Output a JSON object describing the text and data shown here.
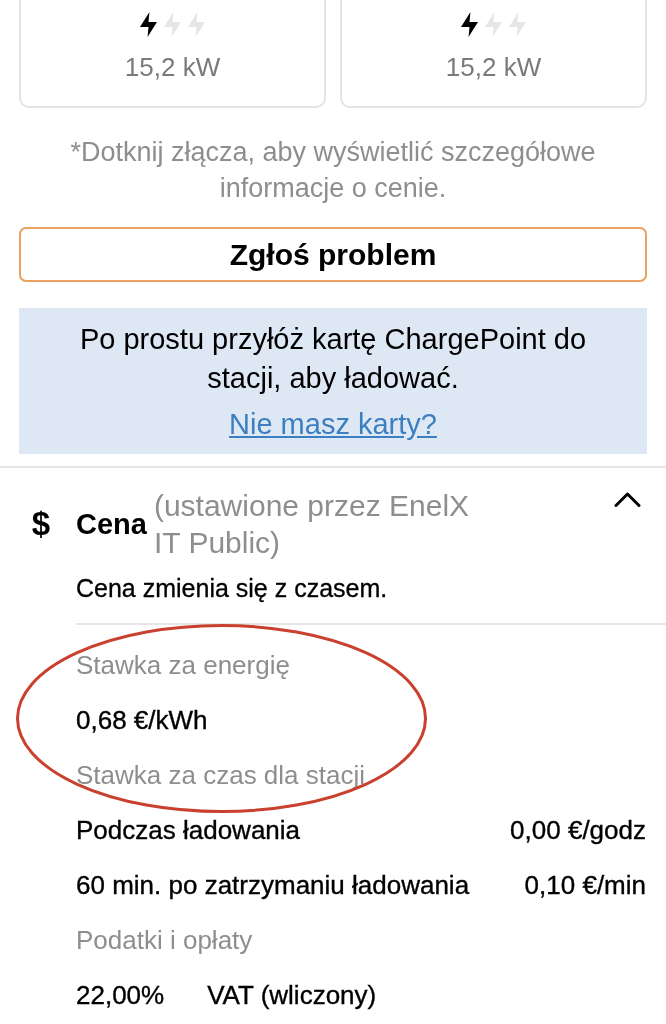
{
  "connectors": [
    {
      "stars": 1,
      "power": "15,2 kW"
    },
    {
      "stars": 1,
      "power": "15,2 kW"
    }
  ],
  "connector_hint": "*Dotknij złącza, aby wyświetlić szczegółowe informacje o cenie.",
  "report_button": {
    "label": "Zgłoś problem"
  },
  "card_notice": {
    "text": "Po prostu przyłóż kartę ChargePoint do stacji, aby ładować.",
    "link": "Nie masz karty?"
  },
  "price": {
    "symbol": "$",
    "title": "Cena",
    "provider": "(ustawione przez EnelX IT Public)",
    "expanded": true,
    "note": "Cena zmienia się z czasem.",
    "circled": true,
    "sections": [
      {
        "heading": "Stawka za energię",
        "rows": [
          {
            "kind": "amount",
            "value": "0,68 €/kWh"
          }
        ]
      },
      {
        "heading": "Stawka za czas dla stacji",
        "rows": [
          {
            "kind": "rate",
            "label": "Podczas ładowania",
            "value": "0,00 €/godz"
          },
          {
            "kind": "rate",
            "label": "60 min. po zatrzymaniu ładowania",
            "value": "0,10 €/min"
          }
        ]
      },
      {
        "heading": "Podatki i opłaty",
        "rows": [
          {
            "kind": "tax",
            "label": "22,00%",
            "value": "VAT (wliczony)"
          }
        ]
      }
    ]
  }
}
